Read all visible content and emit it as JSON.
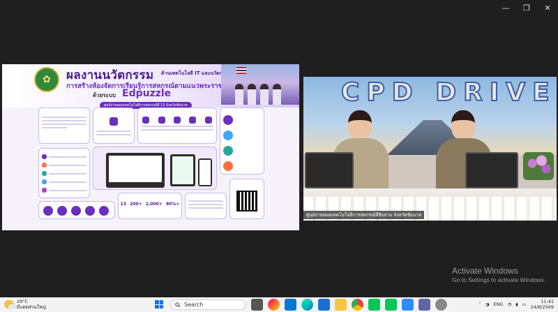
{
  "window": {
    "minimize": "—",
    "maximize": "❐",
    "close": "✕"
  },
  "slide": {
    "title": "ผลงานนวัตกรรม",
    "tagline": "ด้านเทคโนโลยี IT และนวัตกรรม",
    "subtitle": "การสร้างห้องจัดการเรียนรู้การสหกรณ์ตามแนวพระราชดำริ",
    "system_label": "ด้วยระบบ",
    "brand": "Edpuzzle",
    "note": "ศูนย์ถ่ายทอดเทคโนโลยีการสหกรณ์ที่ 13 จังหวัดชัยนาท",
    "stats": [
      "13",
      "200+",
      "2,000+",
      "80%+"
    ]
  },
  "video": {
    "banner_text": "CPD DRIVE",
    "caption": "ศูนย์ถ่ายทอดเทคโนโลยีการสหกรณ์ที่สิบสาม จังหวัดชัยนาท"
  },
  "watermark": {
    "title": "Activate Windows",
    "subtitle": "Go to Settings to activate Windows."
  },
  "taskbar": {
    "temperature": "29°C",
    "weather_desc": "มีแดดส่วนใหญ่",
    "search_placeholder": "Search",
    "language": "ENG",
    "time": "11:41",
    "date": "24/8/2569"
  },
  "colors": {
    "accent": "#6a2fbf",
    "taskbar": "#f3f3f3"
  }
}
